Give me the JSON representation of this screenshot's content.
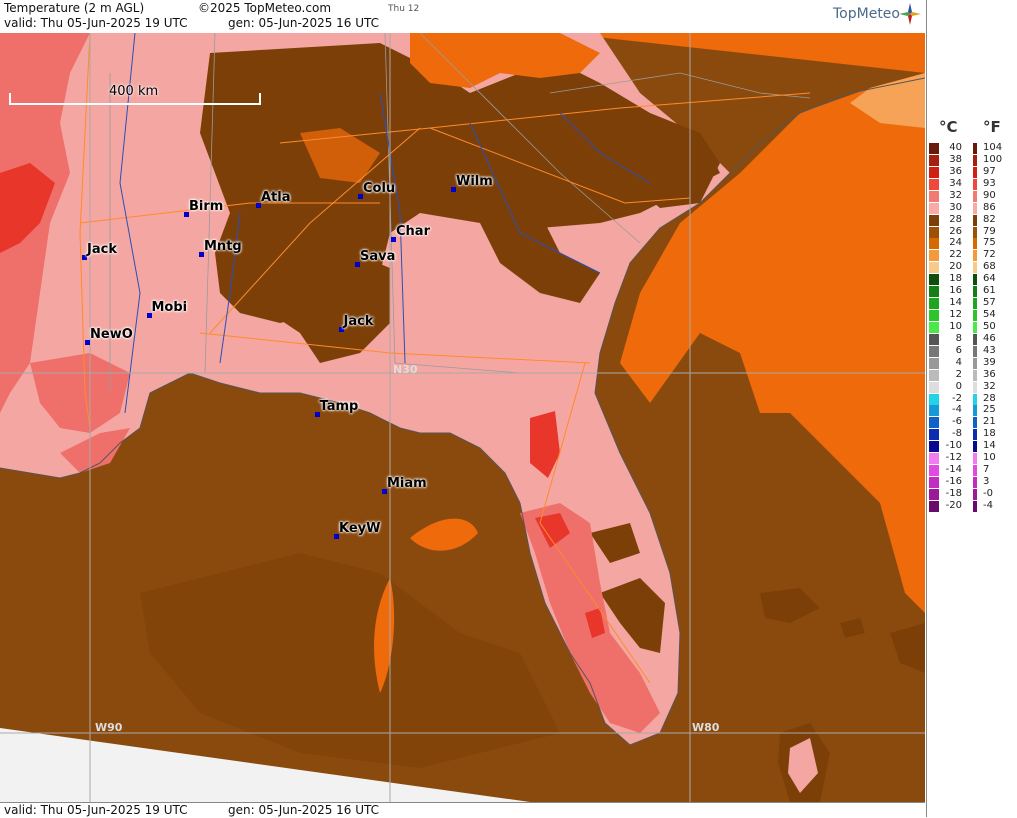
{
  "header": {
    "title": "Temperature (2 m AGL)",
    "copyright": "©2025 TopMeteo.com",
    "day_label": "Thu 12",
    "valid": "valid:  Thu  05-Jun-2025  19 UTC",
    "gen": "gen:  05-Jun-2025 16 UTC",
    "logo": "TopMeteo"
  },
  "footer": {
    "valid": "valid:  Thu  05-Jun-2025  19 UTC",
    "gen": "gen:  05-Jun-2025 16 UTC"
  },
  "map": {
    "scale_label": "400 km",
    "cities": [
      {
        "name": "Birm",
        "lon": -86.8,
        "lat": 33.5
      },
      {
        "name": "Atla",
        "lon": -84.4,
        "lat": 33.75
      },
      {
        "name": "Colu",
        "lon": -81.0,
        "lat": 34.0
      },
      {
        "name": "Wilm",
        "lon": -77.9,
        "lat": 34.2
      },
      {
        "name": "Jack",
        "lon": -90.2,
        "lat": 32.3
      },
      {
        "name": "Mntg",
        "lon": -86.3,
        "lat": 32.4
      },
      {
        "name": "Char",
        "lon": -79.9,
        "lat": 32.8
      },
      {
        "name": "Sava",
        "lon": -81.1,
        "lat": 32.1
      },
      {
        "name": "Mobi",
        "lon": -88.05,
        "lat": 30.7
      },
      {
        "name": "Jack",
        "lon": -81.65,
        "lat": 30.3
      },
      {
        "name": "NewO",
        "lon": -90.1,
        "lat": 29.95
      },
      {
        "name": "Tamp",
        "lon": -82.45,
        "lat": 27.95
      },
      {
        "name": "Miam",
        "lon": -80.2,
        "lat": 25.8
      },
      {
        "name": "KeyW",
        "lon": -81.8,
        "lat": 24.55
      }
    ],
    "grid_labels": [
      "N30",
      "W90",
      "W80"
    ],
    "colors": {
      "sea_28": "#8b4a0d",
      "land_30": "#f4a7a2",
      "land_28": "#7d3f08",
      "warm_32": "#ef6f6a",
      "hot_34": "#e8362a",
      "sea_24": "#ee6a0a",
      "sea_22": "#f7a357",
      "grid": "#aaaaaa",
      "roads": "#ff8a2a",
      "rivers": "#2a4fb8",
      "noData": "#f2f2f2"
    }
  },
  "legend": {
    "celsius_unit": "°C",
    "fahrenheit_unit": "°F",
    "entries": [
      {
        "c": "40",
        "f": "104",
        "color": "#6a1a0a"
      },
      {
        "c": "38",
        "f": "100",
        "color": "#a4200f"
      },
      {
        "c": "36",
        "f": "97",
        "color": "#d21f14"
      },
      {
        "c": "34",
        "f": "93",
        "color": "#f0483a"
      },
      {
        "c": "32",
        "f": "90",
        "color": "#f27a74"
      },
      {
        "c": "30",
        "f": "86",
        "color": "#f7aaa6"
      },
      {
        "c": "28",
        "f": "82",
        "color": "#7d3f08"
      },
      {
        "c": "26",
        "f": "79",
        "color": "#9b5208"
      },
      {
        "c": "24",
        "f": "75",
        "color": "#d66a00"
      },
      {
        "c": "22",
        "f": "72",
        "color": "#f39a3a"
      },
      {
        "c": "20",
        "f": "68",
        "color": "#f7c98a"
      },
      {
        "c": "18",
        "f": "64",
        "color": "#0e4f0e"
      },
      {
        "c": "16",
        "f": "61",
        "color": "#157f15"
      },
      {
        "c": "14",
        "f": "57",
        "color": "#1fa51f"
      },
      {
        "c": "12",
        "f": "54",
        "color": "#2cc52c"
      },
      {
        "c": "10",
        "f": "50",
        "color": "#4be84b"
      },
      {
        "c": "8",
        "f": "46",
        "color": "#555555"
      },
      {
        "c": "6",
        "f": "43",
        "color": "#777777"
      },
      {
        "c": "4",
        "f": "39",
        "color": "#999999"
      },
      {
        "c": "2",
        "f": "36",
        "color": "#bbbbbb"
      },
      {
        "c": "0",
        "f": "32",
        "color": "#dddddd"
      },
      {
        "c": "-2",
        "f": "28",
        "color": "#22d3e8"
      },
      {
        "c": "-4",
        "f": "25",
        "color": "#1599d8"
      },
      {
        "c": "-6",
        "f": "21",
        "color": "#0f62c7"
      },
      {
        "c": "-8",
        "f": "18",
        "color": "#0a2db3"
      },
      {
        "c": "-10",
        "f": "14",
        "color": "#0a0a90"
      },
      {
        "c": "-12",
        "f": "10",
        "color": "#f07cf0"
      },
      {
        "c": "-14",
        "f": "7",
        "color": "#e04ae0"
      },
      {
        "c": "-16",
        "f": "3",
        "color": "#c32bc3"
      },
      {
        "c": "-18",
        "f": "-0",
        "color": "#9a1a9a"
      },
      {
        "c": "-20",
        "f": "-4",
        "color": "#6a0a6a"
      }
    ]
  }
}
